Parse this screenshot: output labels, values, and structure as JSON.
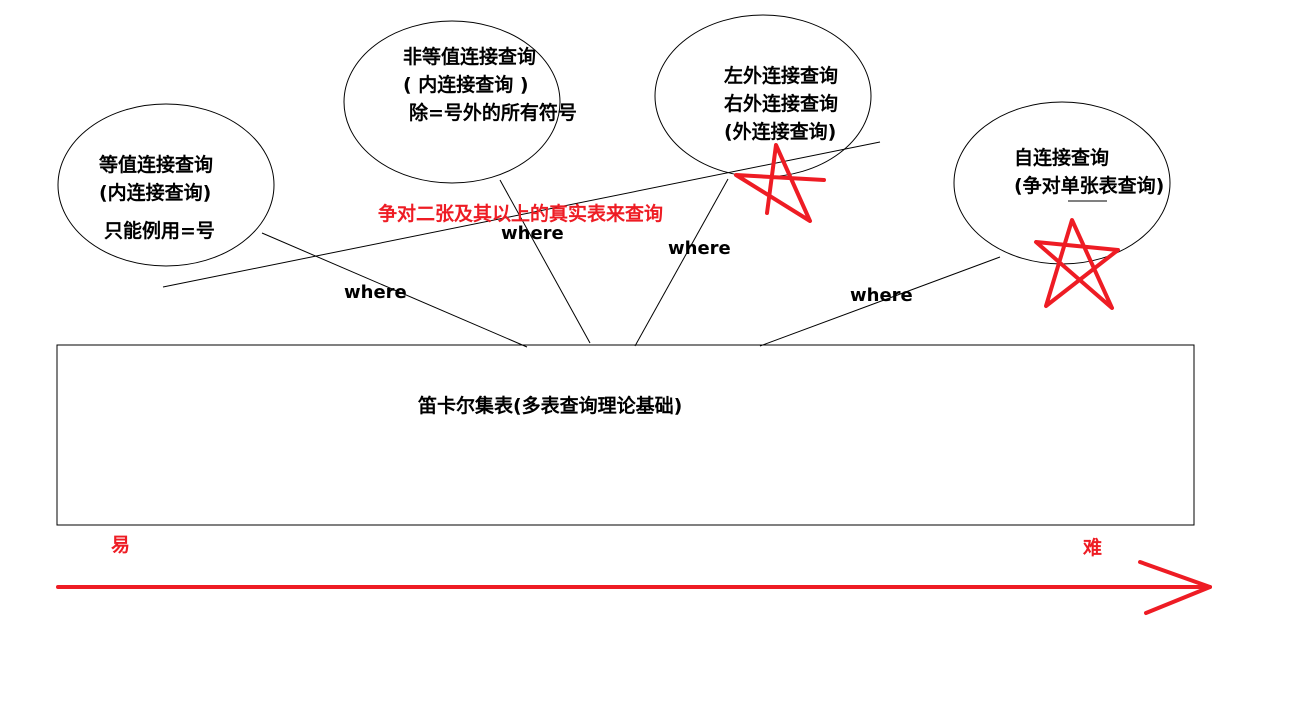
{
  "colors": {
    "ink": "#000000",
    "accent": "#ee1c24",
    "background": "#ffffff"
  },
  "bubbles": {
    "equi": {
      "line1": "等值连接查询",
      "line2": "(内连接查询)",
      "line3": "只能例用=号"
    },
    "non_equi": {
      "line1": "非等值连接查询",
      "line2": "( 内连接查询 )",
      "line3": "除=号外的所有符号"
    },
    "outer": {
      "line1": "左外连接查询",
      "line2": "右外连接查询",
      "line3": "(外连接查询)"
    },
    "self": {
      "line1": "自连接查询",
      "line2": "(争对单张表查询)"
    }
  },
  "connector_label": "where",
  "note": "争对二张及其以上的真实表来查询",
  "base_box": {
    "label": "笛卡尔集表(多表查询理论基础)"
  },
  "difficulty": {
    "easy": "易",
    "hard": "难"
  },
  "marks": [
    "star",
    "star"
  ]
}
